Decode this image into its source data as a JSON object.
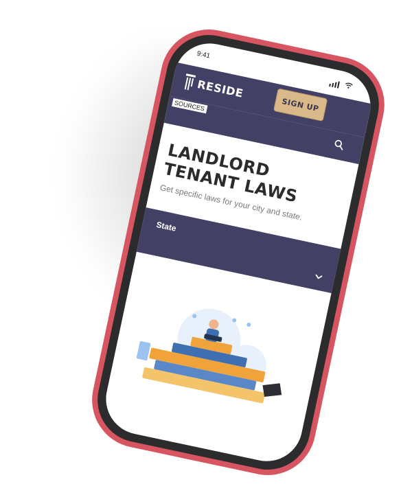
{
  "status": {
    "time": "9:41"
  },
  "nav": {
    "brand": "RESIDE",
    "signup_label": "SIGN UP",
    "resources_label": "SOURCES"
  },
  "hero": {
    "title": "LANDLORD TENANT LAWS",
    "subtitle": "Get specific laws for your city and state."
  },
  "state_select": {
    "label": "State"
  },
  "colors": {
    "frame": "#d75561",
    "nav": "#434066",
    "button": "#d9b98a"
  },
  "icons": {
    "search": "search-icon",
    "chevron": "chevron-down-icon",
    "logo": "column-logo-icon",
    "signal": "signal-icon",
    "wifi": "wifi-icon"
  }
}
